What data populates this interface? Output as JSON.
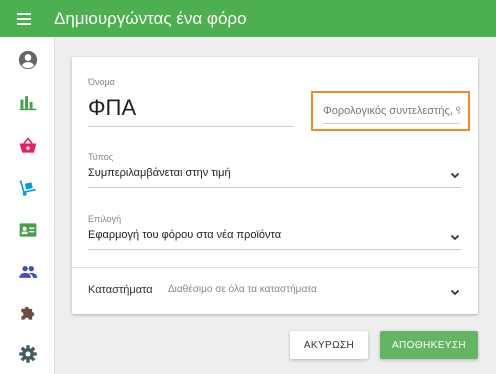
{
  "header": {
    "title": "Δημιουργώντας ένα φόρο"
  },
  "sidebar": {
    "items": [
      {
        "name": "account",
        "icon": "account-circle-icon",
        "color": "#666666"
      },
      {
        "name": "reports",
        "icon": "bar-chart-icon",
        "color": "#43a047"
      },
      {
        "name": "sales",
        "icon": "basket-icon",
        "color": "#e91e63"
      },
      {
        "name": "goods",
        "icon": "dolly-icon",
        "color": "#039be5"
      },
      {
        "name": "employees",
        "icon": "badge-icon",
        "color": "#43a047"
      },
      {
        "name": "customers",
        "icon": "people-icon",
        "color": "#3f51b5"
      },
      {
        "name": "integrations",
        "icon": "puzzle-icon",
        "color": "#6d4c41"
      },
      {
        "name": "settings",
        "icon": "gear-icon",
        "color": "#455a64"
      }
    ]
  },
  "form": {
    "name_label": "Όνομα",
    "name_value": "ΦΠΑ",
    "rate_placeholder": "Φορολογικός συντελεστής, %",
    "type_label": "Τύπος",
    "type_value": "Συμπεριλαμβάνεται στην τιμή",
    "option_label": "Επιλογή",
    "option_value": "Εφαρμογή του φόρου στα νέα προϊόντα",
    "stores_label": "Καταστήματα",
    "stores_value": "Διαθέσιμο σε όλα τα καταστήματα"
  },
  "actions": {
    "cancel": "ΑΚΥΡΩΣΗ",
    "save": "ΑΠΟΘΗΚΕΥΣΗ"
  },
  "colors": {
    "primary": "#4caf50",
    "highlight": "#f08a24"
  }
}
